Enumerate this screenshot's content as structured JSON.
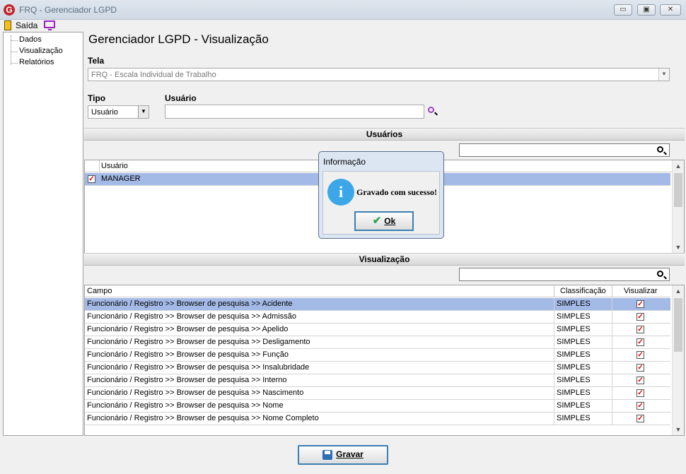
{
  "window": {
    "title": "FRQ - Gerenciador LGPD",
    "logo_letter": "G",
    "minimize": "▭",
    "maximize": "▣",
    "close": "✕"
  },
  "menubar": {
    "exit_label": "Saída"
  },
  "nav": {
    "items": [
      "Dados",
      "Visualização",
      "Relatórios"
    ]
  },
  "page": {
    "title": "Gerenciador LGPD - Visualização"
  },
  "form": {
    "tela_label": "Tela",
    "tela_value": "FRQ - Escala Individual de Trabalho",
    "tipo_label": "Tipo",
    "tipo_value": "Usuário",
    "usuario_label": "Usuário",
    "usuario_value": ""
  },
  "users_section": {
    "title": "Usuários",
    "search_value": "",
    "column": "Usuário",
    "rows": [
      {
        "checked": true,
        "name": "MANAGER"
      }
    ]
  },
  "view_section": {
    "title": "Visualização",
    "search_value": "",
    "columns": [
      "Campo",
      "Classificação",
      "Visualizar"
    ],
    "rows": [
      {
        "campo": "Funcionário / Registro >> Browser de pesquisa >> Acidente",
        "classificacao": "SIMPLES",
        "visualizar": true
      },
      {
        "campo": "Funcionário / Registro >> Browser de pesquisa >> Admissão",
        "classificacao": "SIMPLES",
        "visualizar": true
      },
      {
        "campo": "Funcionário / Registro >> Browser de pesquisa >> Apelido",
        "classificacao": "SIMPLES",
        "visualizar": true
      },
      {
        "campo": "Funcionário / Registro >> Browser de pesquisa >> Desligamento",
        "classificacao": "SIMPLES",
        "visualizar": true
      },
      {
        "campo": "Funcionário / Registro >> Browser de pesquisa >> Função",
        "classificacao": "SIMPLES",
        "visualizar": true
      },
      {
        "campo": "Funcionário / Registro >> Browser de pesquisa >> Insalubridade",
        "classificacao": "SIMPLES",
        "visualizar": true
      },
      {
        "campo": "Funcionário / Registro >> Browser de pesquisa >> Interno",
        "classificacao": "SIMPLES",
        "visualizar": true
      },
      {
        "campo": "Funcionário / Registro >> Browser de pesquisa >> Nascimento",
        "classificacao": "SIMPLES",
        "visualizar": true
      },
      {
        "campo": "Funcionário / Registro >> Browser de pesquisa >> Nome",
        "classificacao": "SIMPLES",
        "visualizar": true
      },
      {
        "campo": "Funcionário / Registro >> Browser de pesquisa >> Nome Completo",
        "classificacao": "SIMPLES",
        "visualizar": true
      }
    ]
  },
  "dialog": {
    "title": "Informação",
    "icon_letter": "i",
    "message": "Gravado com sucesso!",
    "ok_label": "Ok"
  },
  "footer": {
    "save_label": "Gravar"
  },
  "colors": {
    "selected_row": "#a3b9e6",
    "check_red": "#dd0000"
  }
}
